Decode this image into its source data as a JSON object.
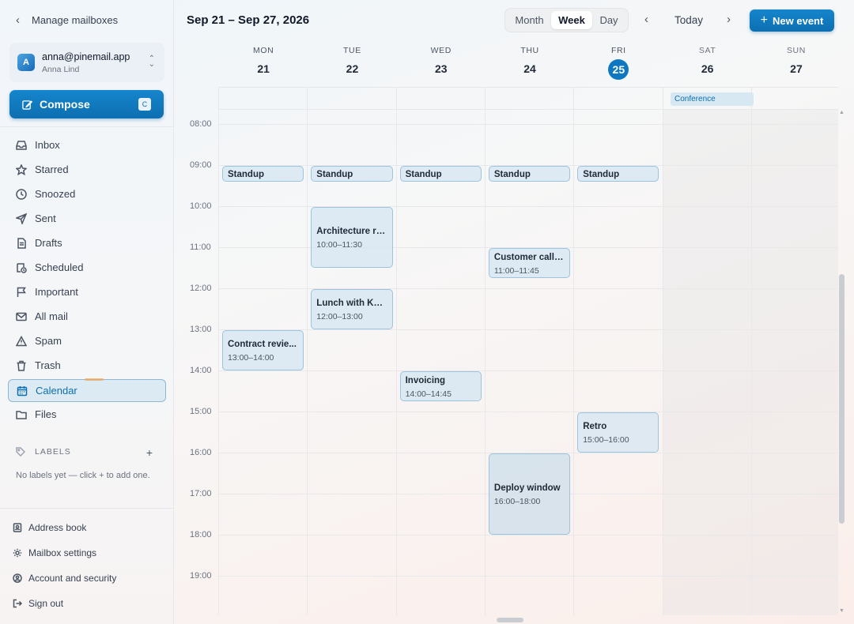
{
  "sidebar": {
    "back_label": "Manage mailboxes",
    "account": {
      "email": "anna@pinemail.app",
      "name": "Anna Lind",
      "initial": "A"
    },
    "compose": {
      "label": "Compose",
      "shortcut": "C"
    },
    "nav": [
      {
        "label": "Inbox",
        "icon": "inbox-icon"
      },
      {
        "label": "Starred",
        "icon": "star-icon"
      },
      {
        "label": "Snoozed",
        "icon": "clock-icon"
      },
      {
        "label": "Sent",
        "icon": "send-icon"
      },
      {
        "label": "Drafts",
        "icon": "draft-icon"
      },
      {
        "label": "Scheduled",
        "icon": "scheduled-icon"
      },
      {
        "label": "Important",
        "icon": "flag-icon"
      },
      {
        "label": "All mail",
        "icon": "mail-icon"
      },
      {
        "label": "Spam",
        "icon": "warning-icon"
      },
      {
        "label": "Trash",
        "icon": "trash-icon"
      },
      {
        "label": "Calendar",
        "icon": "calendar-icon",
        "active": true
      },
      {
        "label": "Files",
        "icon": "folder-icon"
      }
    ],
    "labels": {
      "heading": "LABELS",
      "empty_text": "No labels yet — click + to add one."
    },
    "footer": [
      {
        "label": "Address book",
        "icon": "address-book-icon"
      },
      {
        "label": "Mailbox settings",
        "icon": "gear-icon"
      },
      {
        "label": "Account and security",
        "icon": "user-circle-icon"
      },
      {
        "label": "Sign out",
        "icon": "sign-out-icon"
      }
    ]
  },
  "toolbar": {
    "range_title": "Sep 21 – Sep 27, 2026",
    "views": [
      "Month",
      "Week",
      "Day"
    ],
    "active_view": "Week",
    "today_label": "Today",
    "new_event_label": "New event"
  },
  "days": [
    {
      "name": "MON",
      "num": "21"
    },
    {
      "name": "TUE",
      "num": "22"
    },
    {
      "name": "WED",
      "num": "23"
    },
    {
      "name": "THU",
      "num": "24"
    },
    {
      "name": "FRI",
      "num": "25",
      "today": true
    },
    {
      "name": "SAT",
      "num": "26"
    },
    {
      "name": "SUN",
      "num": "27"
    }
  ],
  "all_day_events": [
    {
      "title": "Conference",
      "day": 5
    }
  ],
  "hours": [
    "08:00",
    "09:00",
    "10:00",
    "11:00",
    "12:00",
    "13:00",
    "14:00",
    "15:00",
    "16:00",
    "17:00",
    "18:00",
    "19:00"
  ],
  "events": [
    {
      "title": "Standup",
      "day": 0,
      "start": "09:00",
      "end": "09:20"
    },
    {
      "title": "Standup",
      "day": 1,
      "start": "09:00",
      "end": "09:20"
    },
    {
      "title": "Standup",
      "day": 2,
      "start": "09:00",
      "end": "09:20"
    },
    {
      "title": "Standup",
      "day": 3,
      "start": "09:00",
      "end": "09:20"
    },
    {
      "title": "Standup",
      "day": 4,
      "start": "09:00",
      "end": "09:20"
    },
    {
      "title": "Architecture re...",
      "day": 1,
      "start": "10:00",
      "end": "11:30",
      "time": "10:00–11:30"
    },
    {
      "title": "Customer call, ...",
      "day": 3,
      "start": "11:00",
      "end": "11:45",
      "time": "11:00–11:45"
    },
    {
      "title": "Lunch with Karin",
      "day": 1,
      "start": "12:00",
      "end": "13:00",
      "time": "12:00–13:00"
    },
    {
      "title": "Contract revie...",
      "day": 0,
      "start": "13:00",
      "end": "14:00",
      "time": "13:00–14:00"
    },
    {
      "title": "Invoicing",
      "day": 2,
      "start": "14:00",
      "end": "14:45",
      "time": "14:00–14:45"
    },
    {
      "title": "Retro",
      "day": 4,
      "start": "15:00",
      "end": "16:00",
      "time": "15:00–16:00"
    },
    {
      "title": "Deploy window",
      "day": 3,
      "start": "16:00",
      "end": "18:00",
      "time": "16:00–18:00"
    }
  ],
  "colors": {
    "accent": "#0d78bf",
    "event_bg": "#d4e6f2",
    "event_border": "#9cc4de"
  }
}
